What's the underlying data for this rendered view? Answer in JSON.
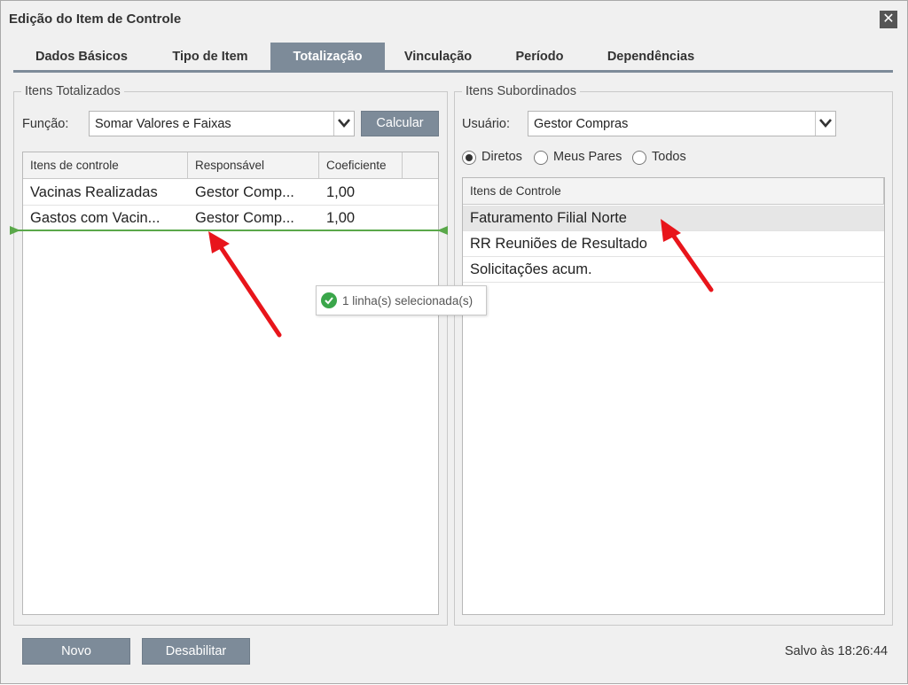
{
  "window": {
    "title": "Edição do Item de Controle",
    "close_symbol": "✕"
  },
  "tabs": [
    {
      "label": "Dados Básicos",
      "active": false
    },
    {
      "label": "Tipo de Item",
      "active": false
    },
    {
      "label": "Totalização",
      "active": true
    },
    {
      "label": "Vinculação",
      "active": false
    },
    {
      "label": "Período",
      "active": false
    },
    {
      "label": "Dependências",
      "active": false
    }
  ],
  "totalized": {
    "legend": "Itens Totalizados",
    "function_label": "Função:",
    "function_value": "Somar Valores e Faixas",
    "calculate_button": "Calcular",
    "columns": [
      "Itens de controle",
      "Responsável",
      "Coeficiente"
    ],
    "rows": [
      {
        "item": "Vacinas Realizadas",
        "owner": "Gestor Comp...",
        "coef": "1,00"
      },
      {
        "item": "Gastos com Vacin...",
        "owner": "Gestor Comp...",
        "coef": "1,00"
      }
    ]
  },
  "subordinate": {
    "legend": "Itens Subordinados",
    "user_label": "Usuário:",
    "user_value": "Gestor Compras",
    "filters": [
      {
        "label": "Diretos",
        "checked": true
      },
      {
        "label": "Meus Pares",
        "checked": false
      },
      {
        "label": "Todos",
        "checked": false
      }
    ],
    "column": "Itens de Controle",
    "rows": [
      "Faturamento Filial Norte",
      "RR Reuniões de Resultado",
      "Solicitações acum."
    ]
  },
  "toast": {
    "text": "1 linha(s) selecionada(s)",
    "icon": "check-circle-icon",
    "color": "#3aa64a"
  },
  "footer": {
    "new_button": "Novo",
    "disable_button": "Desabilitar",
    "status_text": "Salvo às 18:26:44"
  },
  "colors": {
    "accent": "#7d8b99",
    "annotation_arrow": "#e8151b",
    "drop_indicator": "#5aa84a"
  }
}
